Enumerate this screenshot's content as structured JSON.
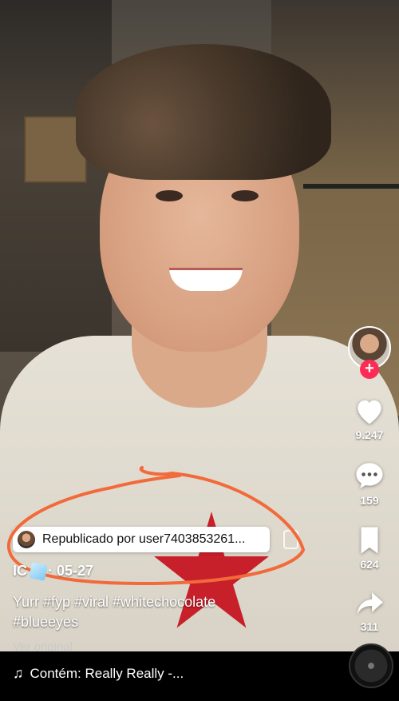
{
  "profile": {
    "avatar_icon": "user-avatar-icon",
    "follow_icon": "plus-icon"
  },
  "actions": {
    "likes": "9.247",
    "comments": "159",
    "saves": "624",
    "shares": "311"
  },
  "repost": {
    "label": "Republicado por user7403853261..."
  },
  "post": {
    "author": "IC",
    "date": "· 05-27",
    "caption_line1": "Yurr #fyp #viral #whitechocolate",
    "caption_line2": "#blueeyes",
    "ver_original": "Ver original"
  },
  "music": {
    "label": "Contém: Really Really -..."
  },
  "colors": {
    "follow_accent": "#fe2c55",
    "annotation": "#f26a3a"
  }
}
